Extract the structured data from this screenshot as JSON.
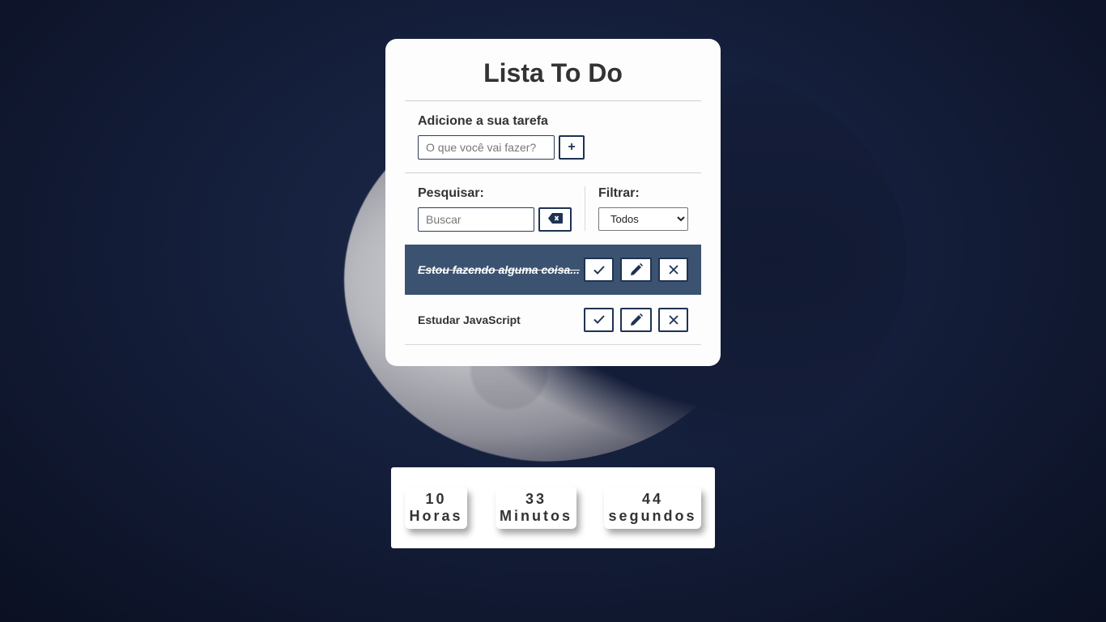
{
  "app": {
    "title": "Lista To Do"
  },
  "add_task": {
    "label": "Adicione a sua tarefa",
    "placeholder": "O que você vai fazer?",
    "value": "",
    "button_label": "+"
  },
  "search": {
    "label": "Pesquisar:",
    "placeholder": "Buscar",
    "value": "",
    "clear_icon": "backspace-icon"
  },
  "filter": {
    "label": "Filtrar:",
    "selected": "Todos",
    "options": [
      "Todos"
    ]
  },
  "todos": [
    {
      "text": "Estou fazendo alguma coisa...",
      "done": true
    },
    {
      "text": "Estudar JavaScript",
      "done": false
    }
  ],
  "todo_actions": {
    "finish_icon": "check-icon",
    "edit_icon": "pencil-icon",
    "remove_icon": "close-icon"
  },
  "clock": {
    "hours": {
      "value": "10",
      "label": "Horas"
    },
    "minutes": {
      "value": "33",
      "label": "Minutos"
    },
    "seconds": {
      "value": "44",
      "label": "segundos"
    }
  },
  "colors": {
    "accent": "#1f3252",
    "done_row": "#3b5370",
    "card": "#fdfdfd"
  }
}
